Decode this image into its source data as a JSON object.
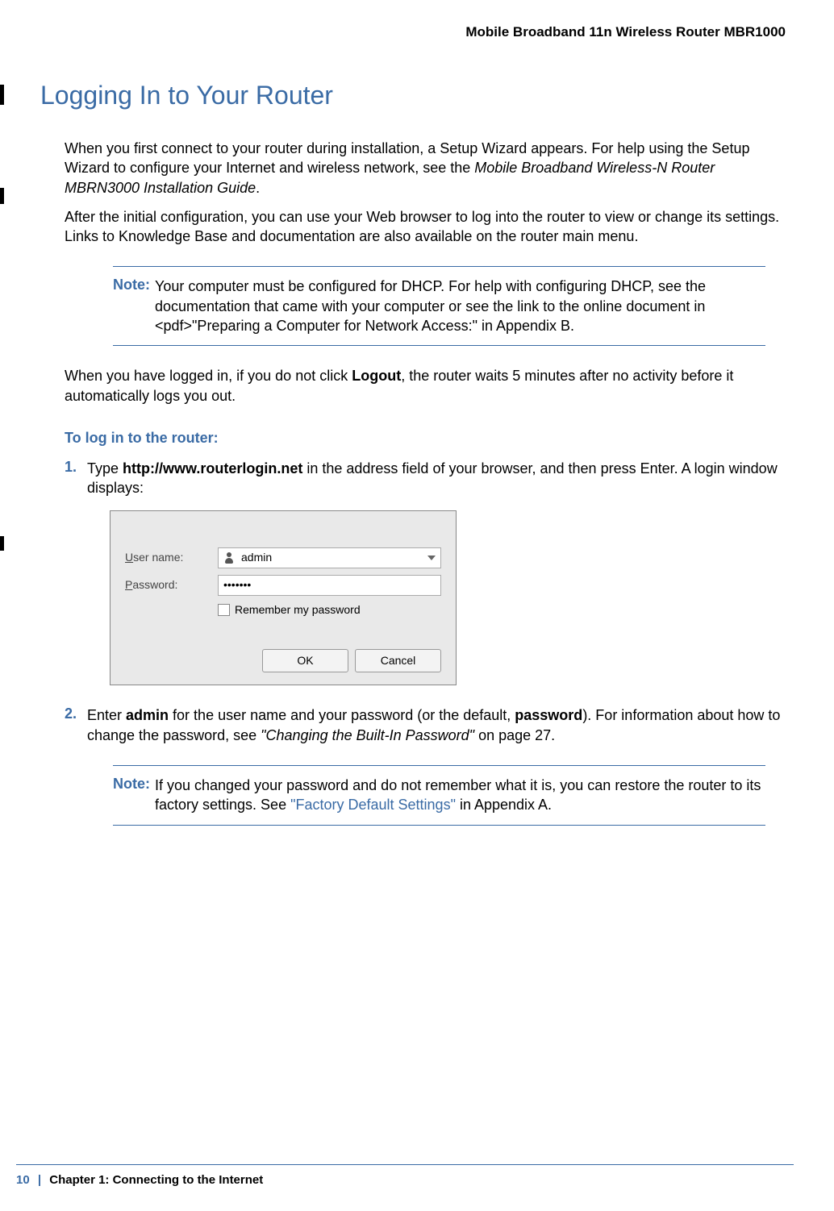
{
  "header": {
    "product": "Mobile Broadband 11n Wireless Router MBR1000"
  },
  "section": {
    "title": "Logging In to Your Router",
    "para1_a": "When you first connect to your router during installation, a Setup Wizard appears. For help using the Setup Wizard to configure your Internet and wireless network, see the ",
    "para1_i": "Mobile Broadband Wireless-N Router MBRN3000 Installation Guide",
    "para1_b": ".",
    "para2": "After the initial configuration, you can use your Web browser to log into the router to view or change its settings. Links to Knowledge Base and documentation are also available on the router main menu.",
    "note1_label": "Note:",
    "note1": "Your computer must be configured for DHCP. For help with configuring DHCP, see the documentation that came with your computer or see the link to the online document in <pdf>\"Preparing a Computer for Network Access:\" in Appendix B.",
    "para3_a": "When you have logged in, if you do not click ",
    "para3_b": "Logout",
    "para3_c": ", the router waits 5 minutes after no activity before it automatically logs you out.",
    "subheading": "To log in to the router:",
    "step1_num": "1.",
    "step1_a": "Type ",
    "step1_b": "http://www.routerlogin.net",
    "step1_c": " in the address field of your browser, and then press Enter. A login window displays:",
    "step2_num": "2.",
    "step2_a": "Enter ",
    "step2_b": "admin",
    "step2_c": " for the user name and your password (or the default, ",
    "step2_d": "password",
    "step2_e": "). For information about how to change the password, see ",
    "step2_f": "\"Changing the Built-In Password\"",
    "step2_g": " on page 27.",
    "note2_label": "Note:",
    "note2_a": "If you changed your password and do not remember what it is, you can restore the router to its factory settings. See ",
    "note2_b": "\"Factory Default Settings\"",
    "note2_c": " in Appendix A."
  },
  "dialog": {
    "user_label_u": "U",
    "user_label_rest": "ser name:",
    "user_value": "admin",
    "pass_label_u": "P",
    "pass_label_rest": "assword:",
    "pass_value": "•••••••",
    "remember_u": "R",
    "remember_rest": "emember my password",
    "ok": "OK",
    "cancel": "Cancel"
  },
  "footer": {
    "page": "10",
    "sep": "|",
    "chapter": "Chapter 1:  Connecting to the Internet"
  }
}
